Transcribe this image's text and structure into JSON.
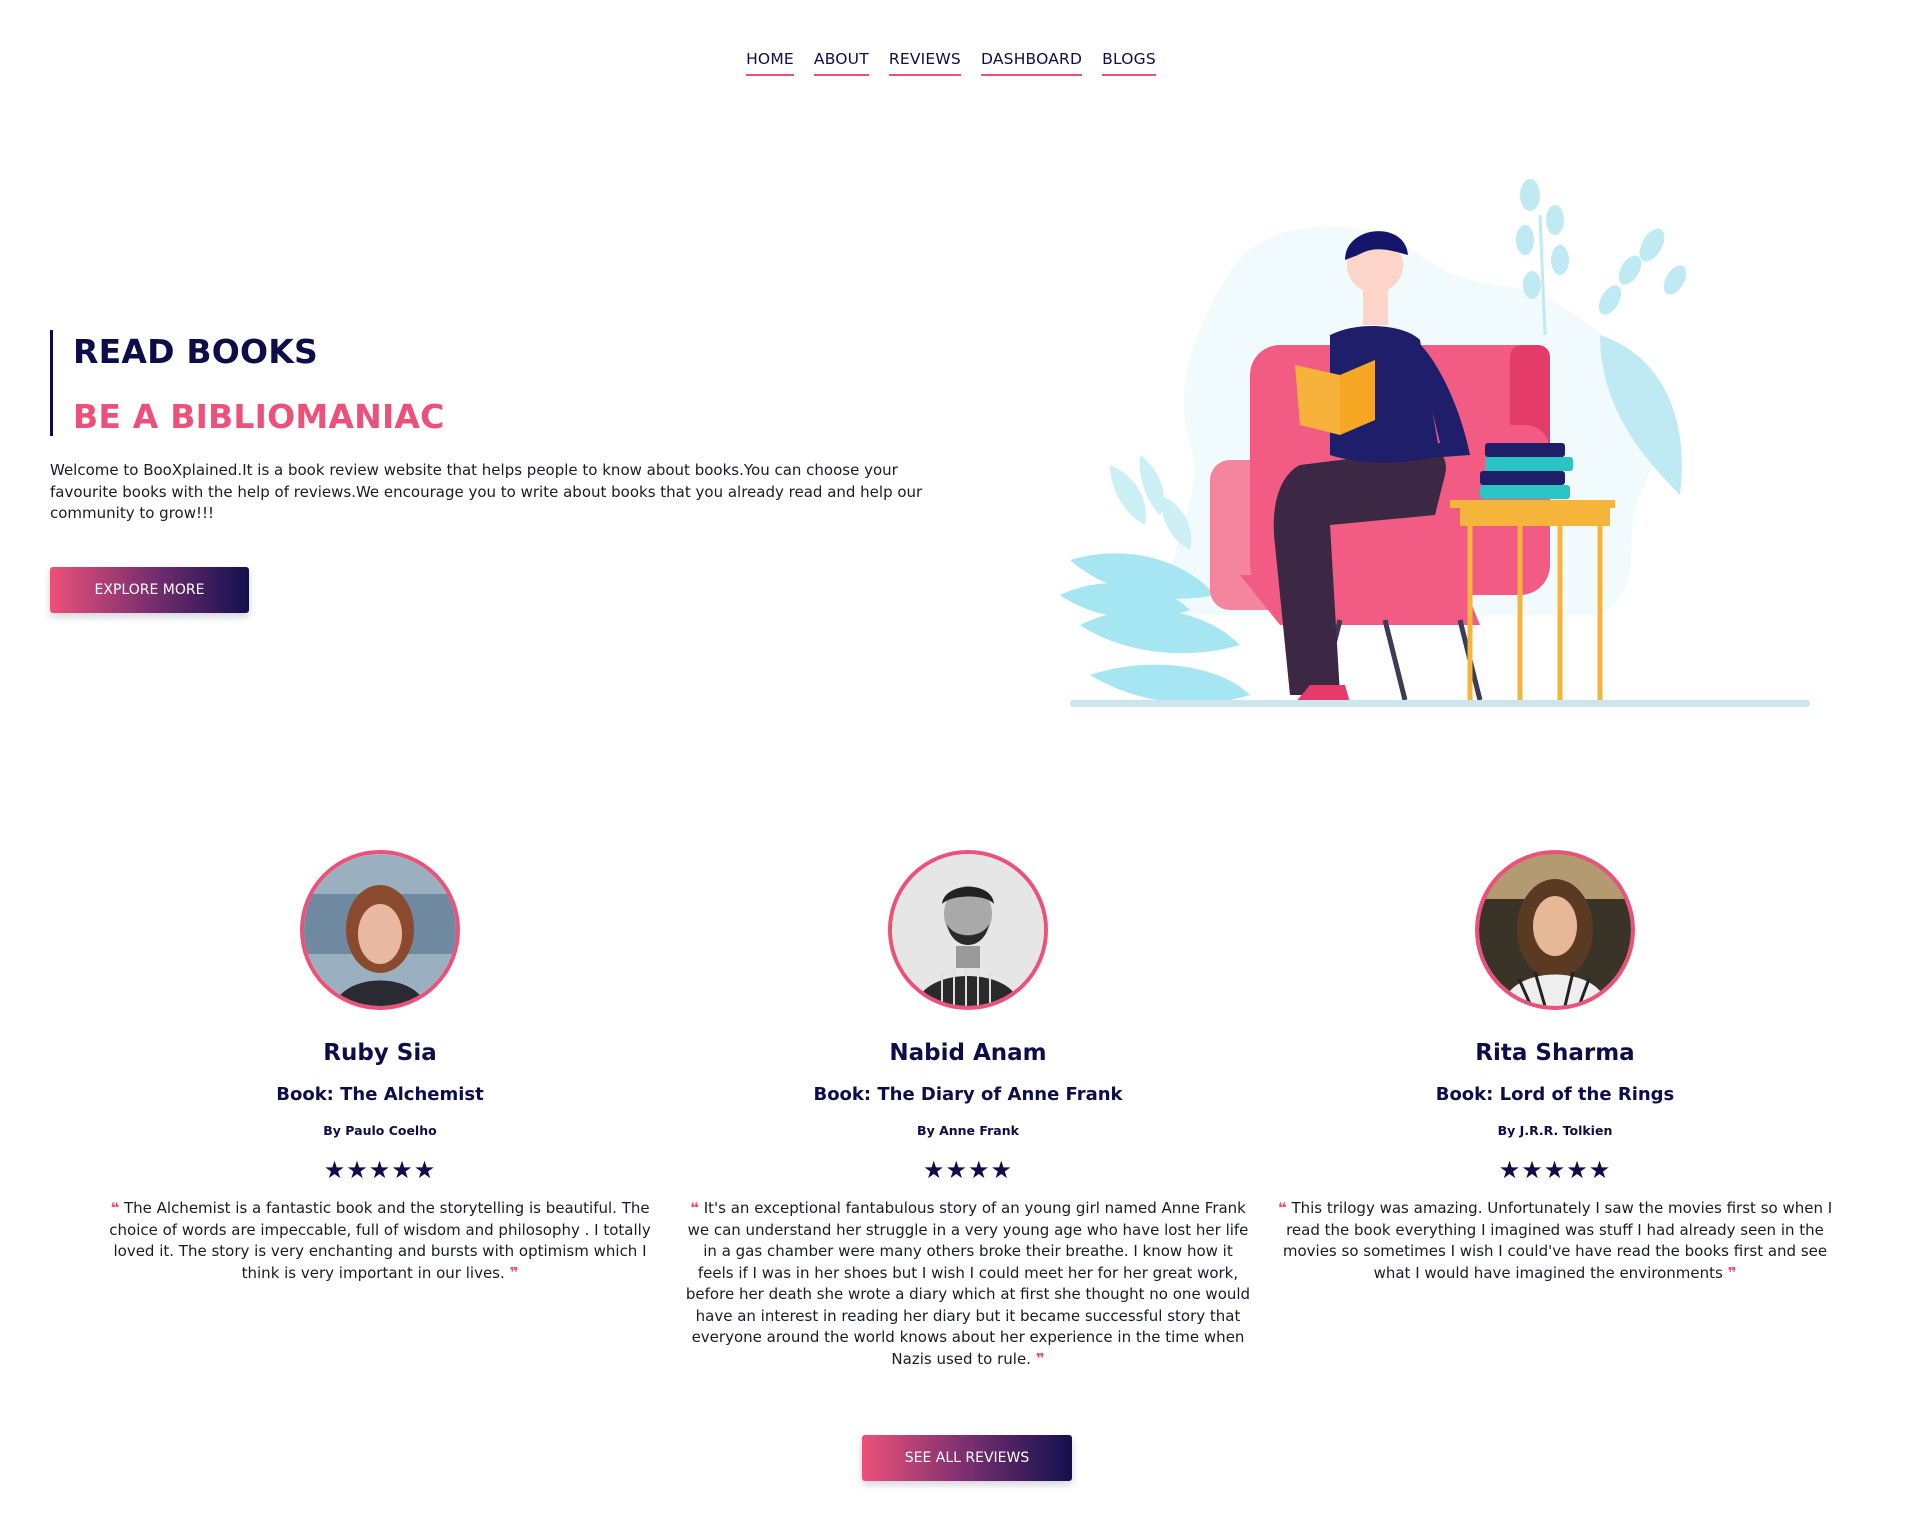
{
  "nav": {
    "items": [
      "HOME",
      "ABOUT",
      "REVIEWS",
      "DASHBOARD",
      "BLOGS"
    ]
  },
  "hero": {
    "title_line1": "READ BOOKS",
    "title_line2": "BE A BIBLIOMANIAC",
    "description": "Welcome to BooXplained.It is a book review website that helps people to know about books.You can choose your favourite books with the help of reviews.We encourage you to write about books that you already read and help our community to grow!!!",
    "explore_button": "EXPLORE MORE"
  },
  "colors": {
    "accent_pink": "#ec5179",
    "navy": "#0d0d4a"
  },
  "reviews": [
    {
      "name": "Ruby Sia",
      "book": "Book: The Alchemist",
      "author": "By Paulo Coelho",
      "stars": "★★★★★",
      "rating": 5,
      "text": "The Alchemist is a fantastic book and the storytelling is beautiful. The choice of words are impeccable, full of wisdom and philosophy . I totally loved it. The story is very enchanting and bursts with optimism which I think is very important in our lives."
    },
    {
      "name": "Nabid Anam",
      "book": "Book: The Diary of Anne Frank",
      "author": "By Anne Frank",
      "stars": "★★★★",
      "rating": 4,
      "text": "It's an exceptional fantabulous story of an young girl named Anne Frank we can understand her struggle in a very young age who have lost her life in a gas chamber were many others broke their breathe. I know how it feels if I was in her shoes but I wish I could meet her for her great work, before her death she wrote a diary which at first she thought no one would have an interest in reading her diary but it became successful story that everyone around the world knows about her experience in the time when Nazis used to rule."
    },
    {
      "name": "Rita Sharma",
      "book": "Book: Lord of the Rings",
      "author": "By J.R.R. Tolkien",
      "stars": "★★★★★",
      "rating": 5,
      "text": "This trilogy was amazing. Unfortunately I saw the movies first so when I read the book everything I imagined was stuff I had already seen in the movies so sometimes I wish I could've have read the books first and see what I would have imagined the environments"
    }
  ],
  "see_all_button": "SEE ALL REVIEWS",
  "quote_open": "❝",
  "quote_close": "❞"
}
